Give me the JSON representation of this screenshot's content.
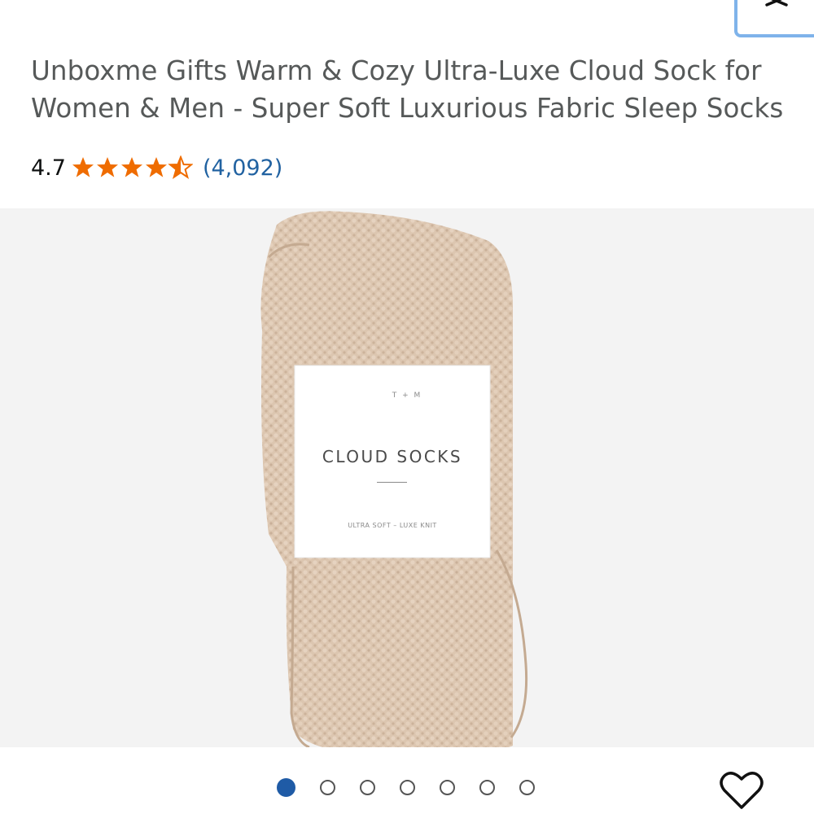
{
  "close_button": {
    "icon": "close-icon"
  },
  "product": {
    "title": "Unboxme Gifts Warm & Cozy Ultra-Luxe Cloud Sock for Women & Men - Super Soft Luxurious Fabric Sleep Socks",
    "rating": {
      "value": "4.7",
      "stars": 4.7,
      "review_count": "(4,092)",
      "star_color": "#ef6c00"
    }
  },
  "image": {
    "band_brand": "T + M",
    "band_title": "CLOUD SOCKS",
    "band_subtitle": "ULTRA SOFT – LUXE KNIT"
  },
  "carousel": {
    "total": 7,
    "active_index": 0,
    "active_color": "#1f5ba6"
  },
  "actions": {
    "wishlist_icon": "heart-icon"
  }
}
